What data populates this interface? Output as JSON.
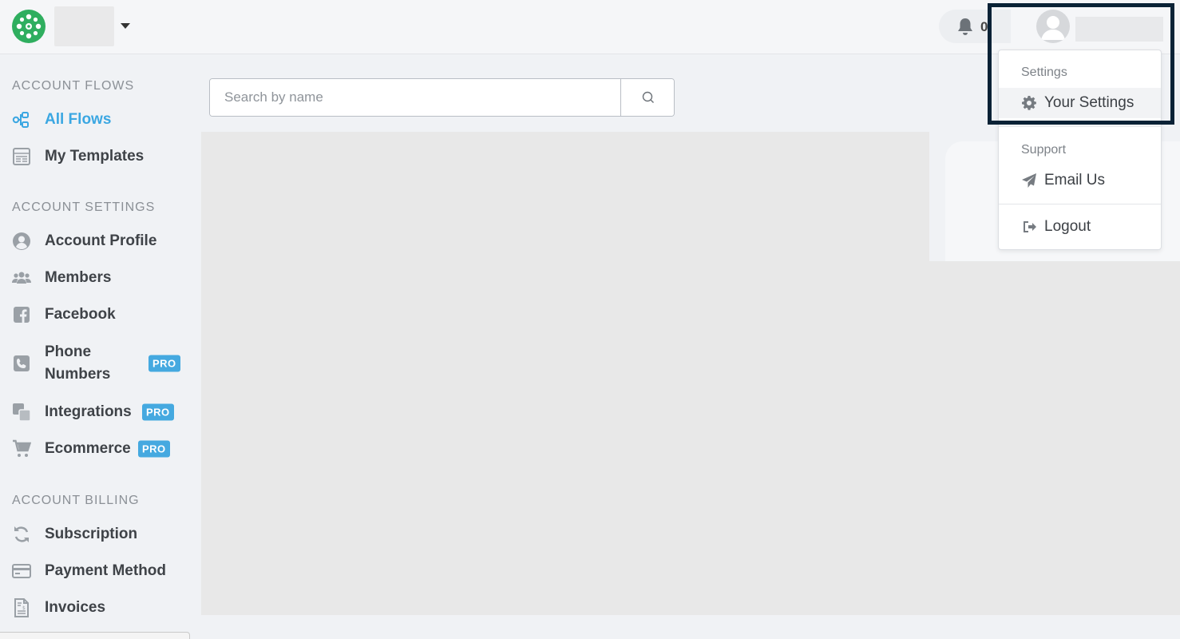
{
  "header": {
    "logo_icon": "flower-logo-icon",
    "workspace_dropdown_icon": "caret-down-icon",
    "notifications": {
      "icon": "bell-icon",
      "count": "0"
    },
    "user": {
      "avatar_icon": "user-avatar-icon"
    }
  },
  "sidebar": {
    "sections": [
      {
        "heading": "ACCOUNT FLOWS",
        "items": [
          {
            "label": "All Flows",
            "icon": "flows-icon",
            "active": true
          },
          {
            "label": "My Templates",
            "icon": "templates-icon"
          }
        ]
      },
      {
        "heading": "ACCOUNT SETTINGS",
        "items": [
          {
            "label": "Account Profile",
            "icon": "user-circle-icon"
          },
          {
            "label": "Members",
            "icon": "members-icon"
          },
          {
            "label": "Facebook",
            "icon": "facebook-icon"
          },
          {
            "label": "Phone Numbers",
            "icon": "phone-icon",
            "badge": "PRO"
          },
          {
            "label": "Integrations",
            "icon": "integrations-icon",
            "badge": "PRO"
          },
          {
            "label": "Ecommerce",
            "icon": "cart-icon",
            "badge": "PRO"
          }
        ]
      },
      {
        "heading": "ACCOUNT BILLING",
        "items": [
          {
            "label": "Subscription",
            "icon": "refresh-icon"
          },
          {
            "label": "Payment Method",
            "icon": "credit-card-icon"
          },
          {
            "label": "Invoices",
            "icon": "invoice-icon"
          }
        ]
      }
    ]
  },
  "main": {
    "search": {
      "placeholder": "Search by name",
      "button_icon": "search-icon"
    }
  },
  "user_menu": {
    "settings_heading": "Settings",
    "your_settings": {
      "label": "Your Settings",
      "icon": "gear-icon"
    },
    "support_heading": "Support",
    "email_us": {
      "label": "Email Us",
      "icon": "paper-plane-icon"
    },
    "logout": {
      "label": "Logout",
      "icon": "sign-out-icon"
    }
  },
  "colors": {
    "accent": "#3ba7e2",
    "pro_badge": "#45a9e0",
    "logo_green": "#2fae5f",
    "highlight_frame": "#0a2236"
  }
}
